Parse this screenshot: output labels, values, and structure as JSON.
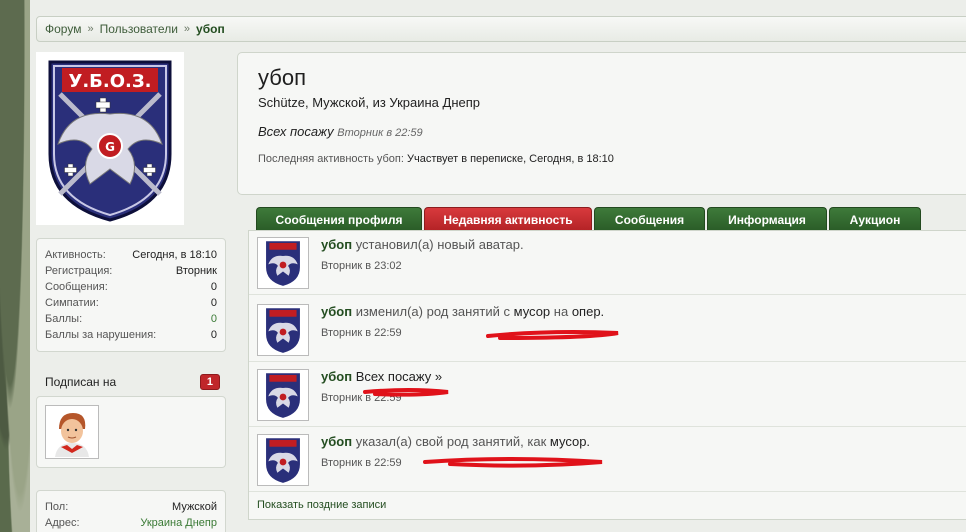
{
  "breadcrumb": {
    "items": [
      "Форум",
      "Пользователи"
    ],
    "separator": "»",
    "current": "убоп"
  },
  "sidebar": {
    "stats": [
      {
        "label": "Активность:",
        "value": "Сегодня, в 18:10"
      },
      {
        "label": "Регистрация:",
        "value": "Вторник"
      },
      {
        "label": "Сообщения:",
        "value": "0"
      },
      {
        "label": "Симпатии:",
        "value": "0"
      },
      {
        "label": "Баллы:",
        "value": "0"
      },
      {
        "label": "Баллы за нарушения:",
        "value": "0"
      }
    ],
    "subscribed_label": "Подписан на",
    "subscribed_count": "1",
    "info": [
      {
        "label": "Пол:",
        "value": "Мужской"
      },
      {
        "label": "Адрес:",
        "value": "Украина Днепр"
      }
    ]
  },
  "profile": {
    "username": "убоп",
    "blurb_prefix": "Schütze, Мужской, из",
    "location": "Украина Днепр",
    "status_text": "Всех посажу",
    "status_date": "Вторник в 22:59",
    "last_activity_label": "Последняя активность убоп:",
    "last_activity_value": "Участвует в переписке, Сегодня, в 18:10"
  },
  "tabs": [
    {
      "label": "Сообщения профиля",
      "active": false
    },
    {
      "label": "Недавняя активность",
      "active": true
    },
    {
      "label": "Сообщения",
      "active": false
    },
    {
      "label": "Информация",
      "active": false
    },
    {
      "label": "Аукцион",
      "active": false
    }
  ],
  "feed": {
    "items": [
      {
        "who": "убоп",
        "text": "установил(а) новый аватар.",
        "time": "Вторник в 23:02"
      },
      {
        "who": "убоп",
        "text1": "изменил(а) род занятий с",
        "obj1": "мусор",
        "text2": "на",
        "obj2": "опер.",
        "time": "Вторник в 22:59"
      },
      {
        "who": "убоп",
        "obj1": "Всех посажу »",
        "time": "Вторник в 22:59"
      },
      {
        "who": "убоп",
        "text1": "указал(а) свой род занятий, как",
        "obj1": "мусор.",
        "time": "Вторник в 22:59"
      }
    ],
    "more_label": "Показать поздние записи"
  },
  "colors": {
    "tab_green": "#2f6a2b",
    "tab_red": "#c6282b",
    "badge_red": "#c0262a",
    "scribble_red": "#e0121a"
  },
  "icons": {
    "avatar": "uboz-emblem-icon",
    "follower_avatar": "boy-avatar-icon"
  }
}
